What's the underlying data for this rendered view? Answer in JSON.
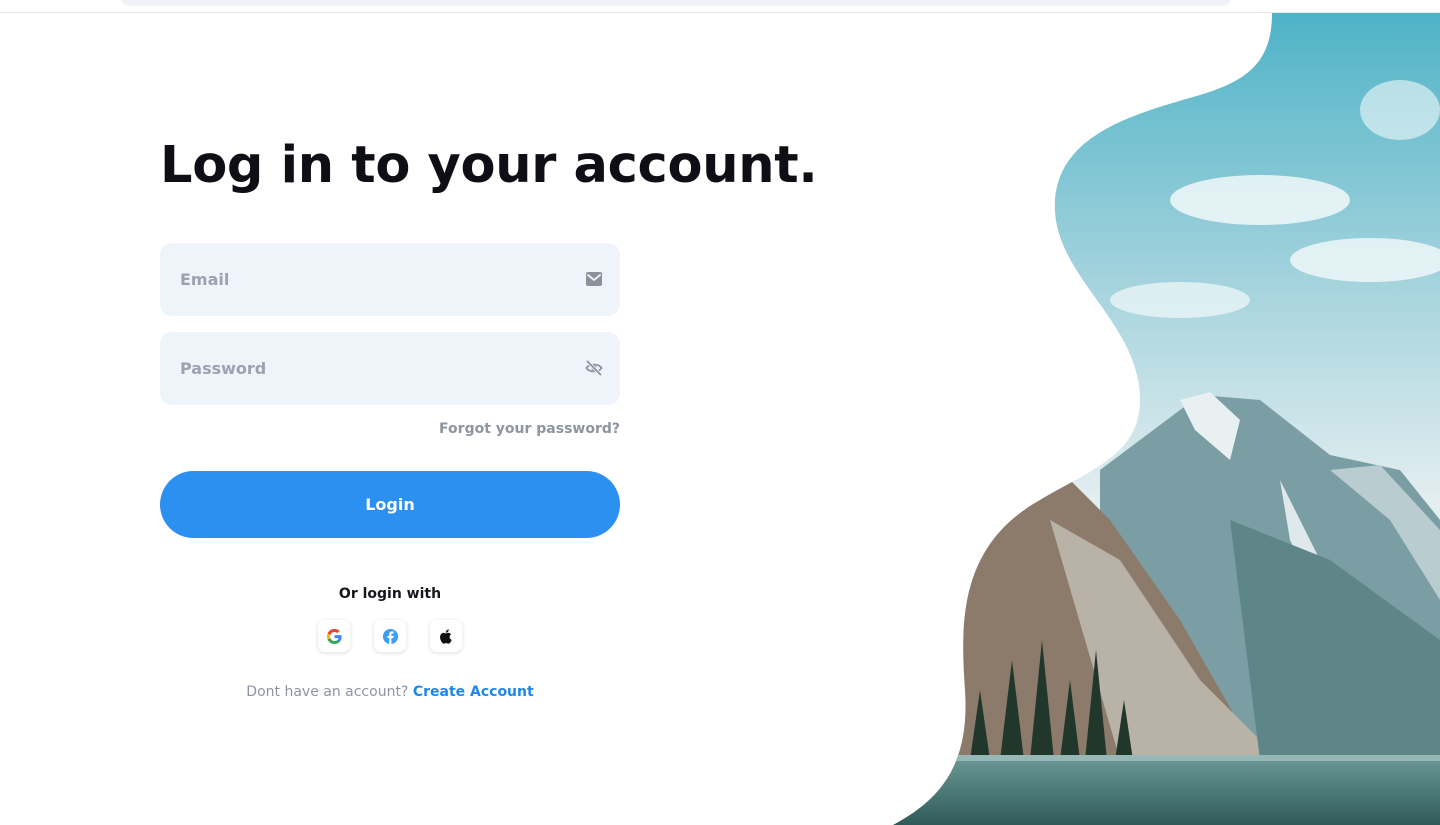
{
  "page": {
    "title": "Log in to your account.",
    "accent_color": "#2c90f1",
    "field_background": "#eff3fa"
  },
  "form": {
    "email_placeholder": "Email",
    "email_icon": "envelope-icon",
    "password_placeholder": "Password",
    "password_icon": "eye-off-icon",
    "forgot_label": "Forgot your password?",
    "login_label": "Login"
  },
  "social": {
    "heading": "Or login with",
    "providers": [
      "google-icon",
      "facebook-icon",
      "apple-icon"
    ]
  },
  "signup": {
    "prompt": "Dont have an account?",
    "link_label": "Create Account"
  },
  "hero": {
    "image": "mountain-lake-landscape"
  }
}
